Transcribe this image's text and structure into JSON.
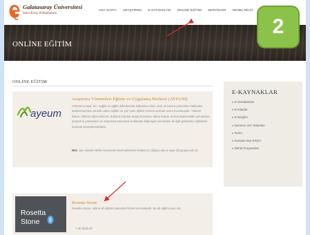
{
  "header": {
    "logo_title": "Galatasaray Üniversitesi",
    "logo_subtitle": "Suna Kıraç Kütüphanesi",
    "nav": [
      "ANA SAYFA",
      "ARAŞTIRMA",
      "E-KAYNAKLAR",
      "ONLINE EĞİTİM",
      "SERVİSLER",
      "GENEL BİLGİ"
    ]
  },
  "banner": {
    "title": "ONLİNE EĞİTİM"
  },
  "step_badge": {
    "number": "2",
    "color": "#8bc34a"
  },
  "breadcrumb": "ONLİNE EĞİTİM",
  "cards": [
    {
      "logo_text": "ayeum",
      "title": "Araştırma Yöntemleri Eğitim ve Uygulama Merkezi (AYEUM)",
      "text": "AYEUM sosyal, fen, sağlık ve eğitim bilimlerinde kullanılan nitel, nicel ve karma yöntemler hakkında araştırmacılara yönelik online eğitim ve yüz yüze eğitim hizmeti vermek üzere kurulmuştur. Yüksek lisans, doktora öğrencilerine, doktora sonrası araştırmacılara, kamu kurum ve kuruluşlarındaki uzmanlara araştırma yöntemleri ve araştırma sürecinde kullanılan bilgisayar yazılımları ile ilgili geliştirilen eğitimleri sunmak amaçlanmaktadır.",
      "note_label": "Not:",
      "note": "Üye olurken lütfen kurumsal email adresinizi kullanınız (@gsu.edu.tr veya @ogr.gsu.edu.tr)"
    },
    {
      "logo_text": "Rosetta Stone",
      "title": "Rosetta Stone",
      "text": "Rosetta Stone, online dil eğitimi alanında hizmet vermektedir. Bu dil eğitim aracı ile;",
      "bullet": "30 farklı dil"
    }
  ],
  "sidebar": {
    "title": "E-KAYNAKLAR",
    "items": [
      "E-Veritabanları",
      "E-Kitaplar",
      "E-Dergiler",
      "Deneme Veri Tabanları",
      "Tezler",
      "Kampüs Dışı Erişim",
      "İntihal Programları"
    ]
  }
}
